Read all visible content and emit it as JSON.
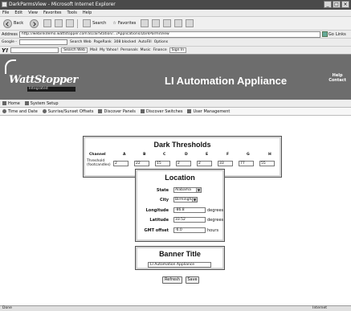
{
  "window": {
    "title": "DarkParmsView - Microsoft Internet Explorer"
  },
  "menu": [
    "File",
    "Edit",
    "View",
    "Favorites",
    "Tools",
    "Help"
  ],
  "toolbar": {
    "back": "Back",
    "search": "Search",
    "favorites": "Favorites"
  },
  "address": {
    "label": "Address",
    "url": "http://webinkdemo.wattstopper.com:81/airStation/.../Applications/DarkParmsView",
    "go": "Go",
    "links": "Links"
  },
  "google_bar": {
    "logo": "Google -",
    "search_web": "Search Web",
    "pagerank": "PageRank",
    "blocked": "308 blocked",
    "autofill": "AutoFill",
    "options": "Options"
  },
  "yahoo_bar": {
    "logo": "Y!",
    "search_web": "Search Web",
    "mail": "Mail",
    "my_yahoo": "My Yahoo!",
    "personals": "Personals",
    "music": "Music",
    "finance": "Finance",
    "sign_in": "Sign In"
  },
  "site": {
    "logo_text": "WattStopper",
    "logo_sub": "Integrated",
    "title": "LI Automation Appliance",
    "help": "Help",
    "contact": "Contact"
  },
  "nav1": [
    {
      "label": "Home",
      "icon": "home-icon"
    },
    {
      "label": "System Setup",
      "icon": "setup-icon"
    }
  ],
  "nav2": [
    {
      "label": "Time and Date",
      "icon": "clock-icon"
    },
    {
      "label": "Sunrise/Sunset Offsets",
      "icon": "sun-icon"
    },
    {
      "label": "Discover Panels",
      "icon": "panel-icon"
    },
    {
      "label": "Discover Switches",
      "icon": "switch-icon"
    },
    {
      "label": "User Management",
      "icon": "user-icon"
    }
  ],
  "dark_thresholds": {
    "title": "Dark Thresholds",
    "channel_label": "Channel",
    "row_label_1": "Threshold",
    "row_label_2": "(footcandles)",
    "channels": [
      "A",
      "B",
      "C",
      "D",
      "E",
      "F",
      "G",
      "H"
    ],
    "values": [
      "2",
      "22",
      "15",
      "2",
      "2",
      "33",
      "77",
      "55"
    ]
  },
  "location": {
    "title": "Location",
    "state_label": "State",
    "state_value": "Alabama",
    "city_label": "City",
    "city_value": "Birmingham",
    "longitude_label": "Longitude",
    "longitude_value": "-86.8",
    "longitude_unit": "degrees",
    "latitude_label": "Latitude",
    "latitude_value": "33.52",
    "latitude_unit": "degrees",
    "gmt_label": "GMT offset",
    "gmt_value": "-6.0",
    "gmt_unit": "hours"
  },
  "banner": {
    "title": "Banner Title",
    "value": "LI Automation Appliance"
  },
  "buttons": {
    "refresh": "Refresh",
    "save": "Save"
  },
  "status": {
    "left": "Done",
    "zone": "Internet"
  }
}
